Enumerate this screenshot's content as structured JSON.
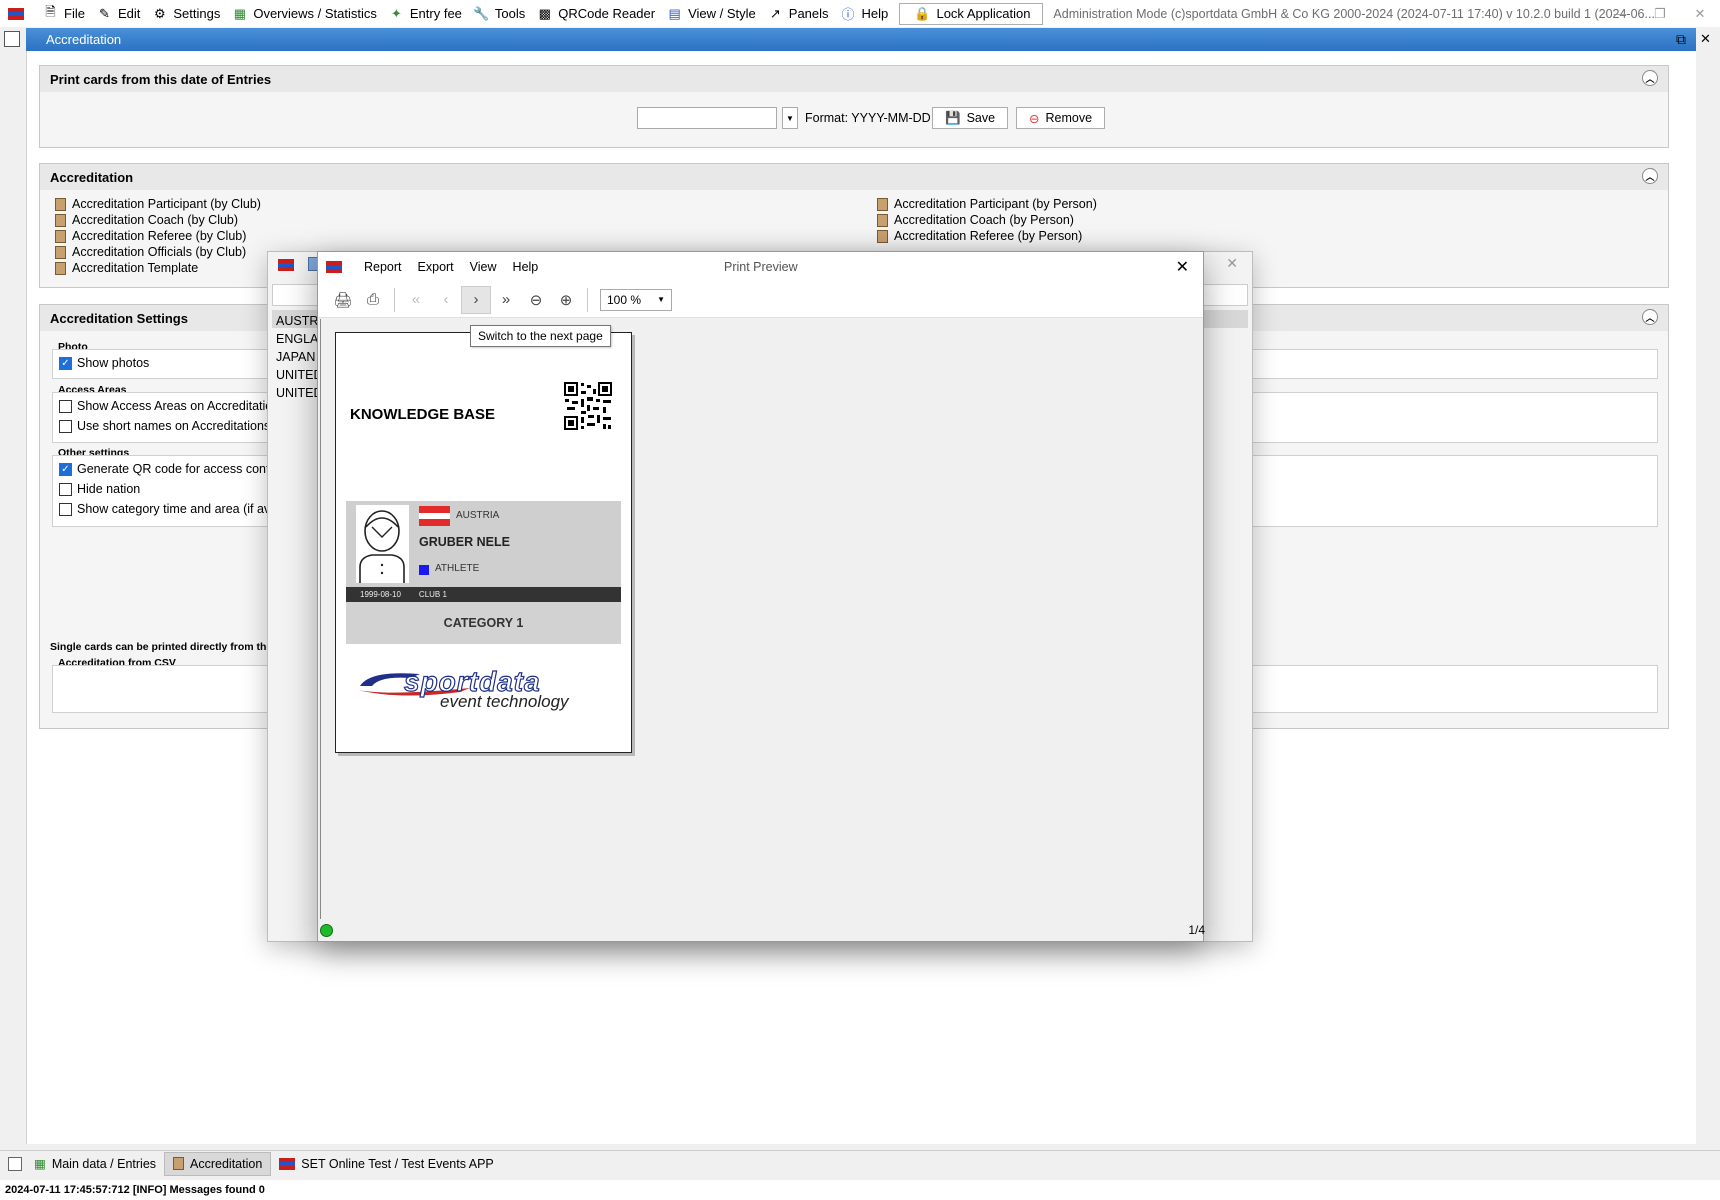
{
  "menubar": {
    "items": [
      {
        "label": "File",
        "icon": "file-icon"
      },
      {
        "label": "Edit",
        "icon": "edit-icon"
      },
      {
        "label": "Settings",
        "icon": "gear-icon"
      },
      {
        "label": "Overviews / Statistics",
        "icon": "chart-icon"
      },
      {
        "label": "Entry fee",
        "icon": "money-icon"
      },
      {
        "label": "Tools",
        "icon": "wrench-icon"
      },
      {
        "label": "QRCode Reader",
        "icon": "qr-icon"
      },
      {
        "label": "View / Style",
        "icon": "view-icon"
      },
      {
        "label": "Panels",
        "icon": "panels-icon"
      },
      {
        "label": "Help",
        "icon": "help-icon"
      }
    ],
    "lock_label": "Lock Application",
    "admin_info": "Administration Mode (c)sportdata GmbH & Co KG 2000-2024 (2024-07-11 17:40)  v 10.2.0 build 1 (2024-06..."
  },
  "window": {
    "title": "Accreditation"
  },
  "print_date_panel": {
    "title": "Print cards from this date of Entries",
    "date_value": "",
    "format_label": "Format: YYYY-MM-DD",
    "save_label": "Save",
    "remove_label": "Remove"
  },
  "accreditation_panel": {
    "title": "Accreditation",
    "left_reports": [
      "Accreditation Participant (by Club)",
      "Accreditation Coach (by Club)",
      "Accreditation Referee (by Club)",
      "Accreditation Officials (by Club)",
      "Accreditation Template"
    ],
    "right_reports": [
      "Accreditation Participant (by Person)",
      "Accreditation Coach (by Person)",
      "Accreditation Referee (by Person)"
    ]
  },
  "settings_panel": {
    "title": "Accreditation Settings",
    "photo_group": "Photo",
    "show_photos": "Show photos",
    "access_group": "Access Areas",
    "show_access": "Show Access Areas on Accreditations",
    "short_names": "Use short names on Accreditations",
    "other_group": "Other settings",
    "qr_code": "Generate QR code for access control",
    "hide_nation": "Hide nation",
    "show_category": "Show category time and area (if available)",
    "single_cards_note": "Single cards can be printed directly from the",
    "csv_group": "Accreditation from CSV"
  },
  "background_window": {
    "list": [
      "AUSTRIA",
      "ENGLAND",
      "JAPAN",
      "UNITED",
      "UNITED"
    ]
  },
  "preview": {
    "title": "Print Preview",
    "menus": [
      "Report",
      "Export",
      "View",
      "Help"
    ],
    "zoom": "100 %",
    "tooltip": "Switch to the next page",
    "page_indicator": "1/4"
  },
  "card": {
    "title": "KNOWLEDGE BASE",
    "country": "AUSTRIA",
    "name": "GRUBER NELE",
    "role": "ATHLETE",
    "birth_date": "1999-08-10",
    "club": "CLUB 1",
    "category": "CATEGORY 1",
    "logo_text": "sportdata",
    "logo_tagline": "event technology"
  },
  "tabs": {
    "items": [
      "Main data / Entries",
      "Accreditation",
      "SET Online Test / Test Events APP"
    ],
    "active": 1
  },
  "status": {
    "message": "2024-07-11 17:45:57:712 [INFO] Messages found 0"
  },
  "colors": {
    "titlebar": "#2b72c2",
    "checkbox": "#1e6fd9",
    "category_marker": "#1a1af0",
    "flag_red": "#e32b2b"
  }
}
